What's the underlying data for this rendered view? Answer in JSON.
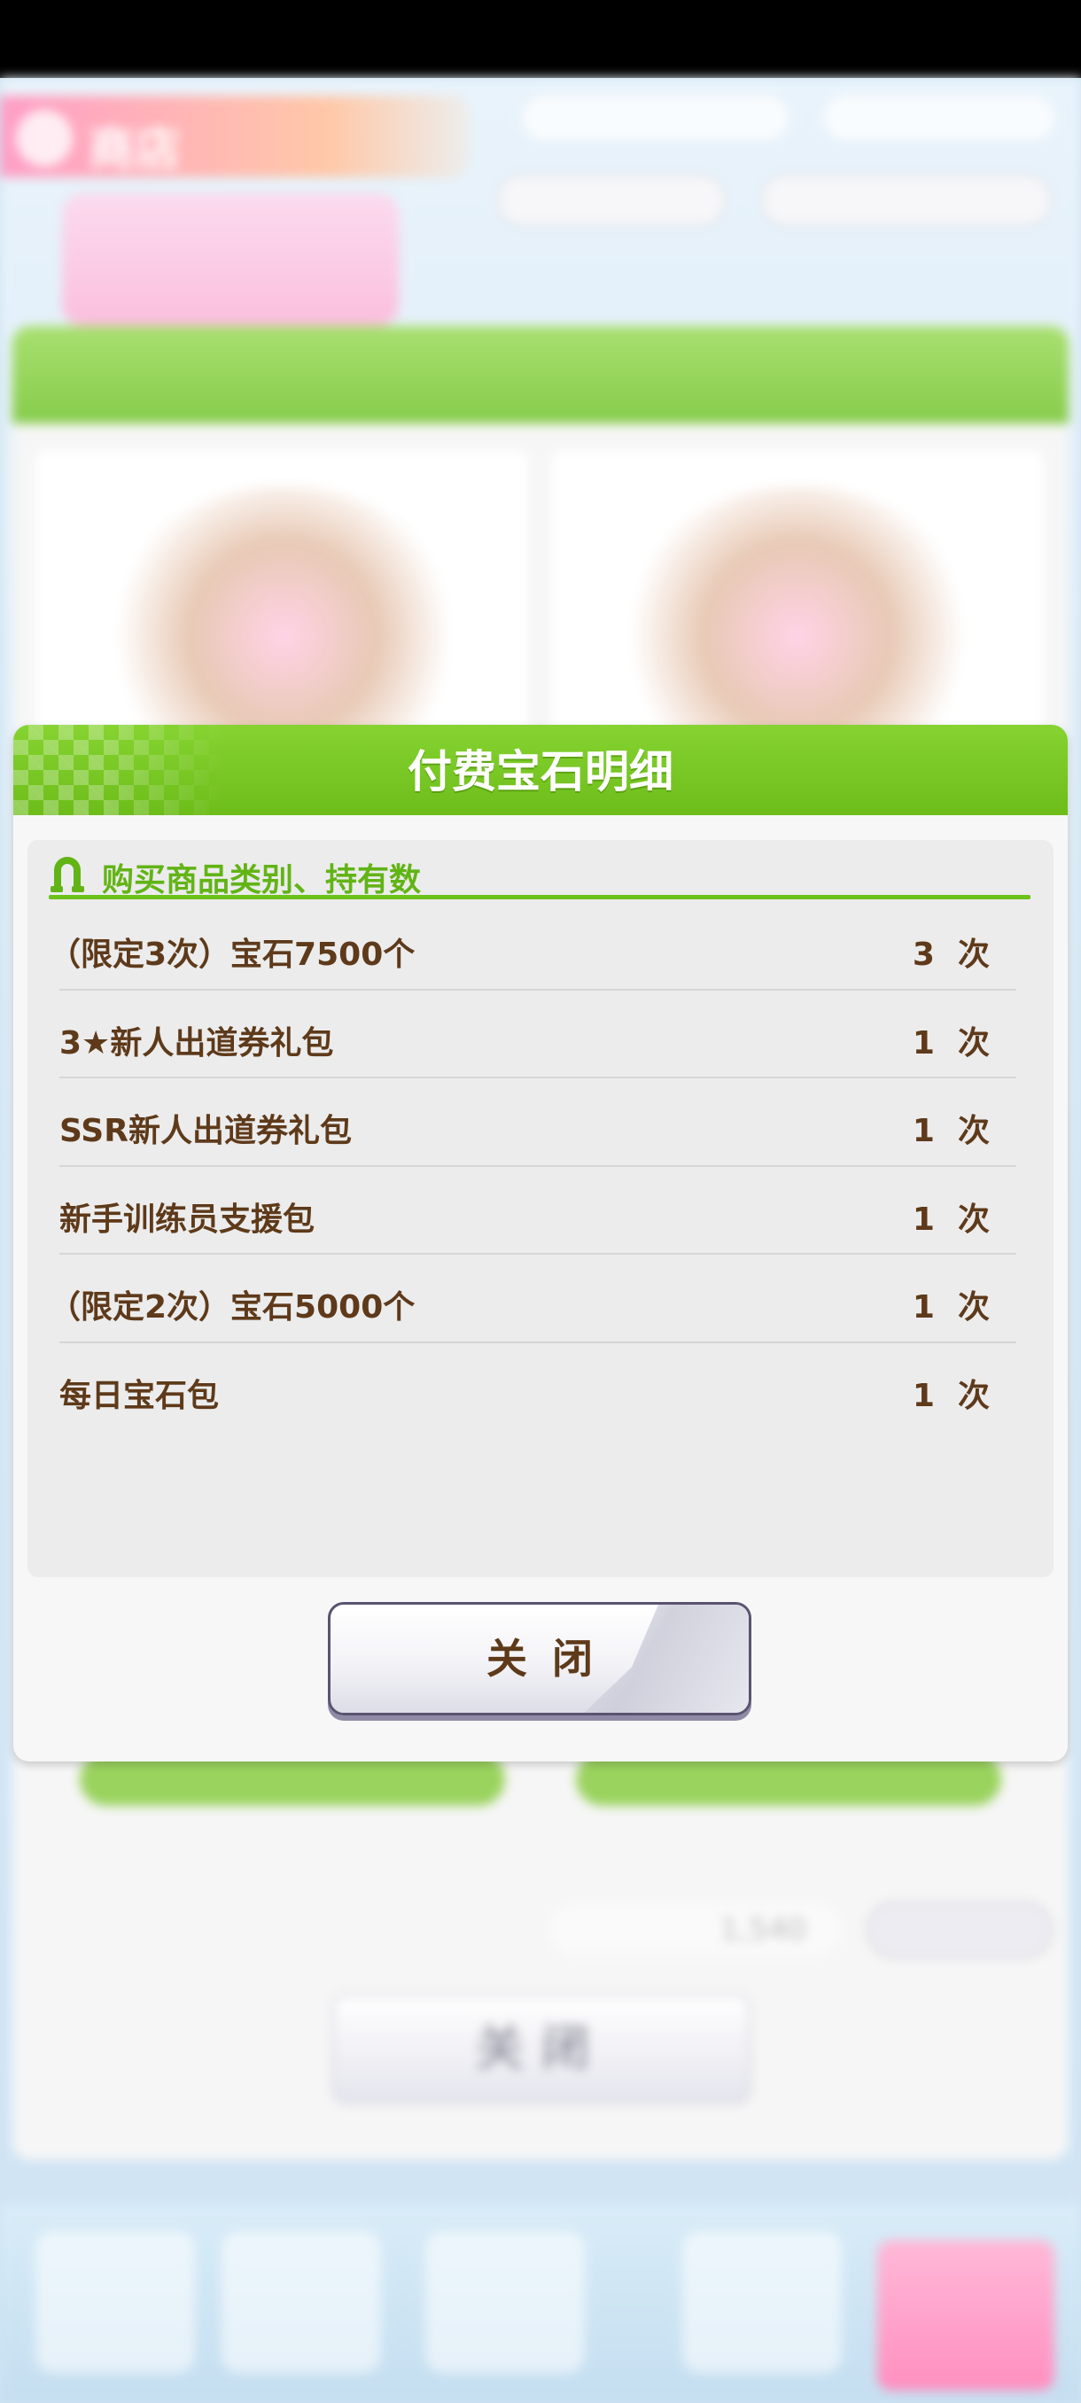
{
  "dialog": {
    "title": "付费宝石明细",
    "section_title": "购买商品类别、持有数",
    "count_unit": "次",
    "items": [
      {
        "name": "（限定3次）宝石7500个",
        "count": "3"
      },
      {
        "name": "3★新人出道券礼包",
        "count": "1"
      },
      {
        "name": "SSR新人出道券礼包",
        "count": "1"
      },
      {
        "name": "新手训练员支援包",
        "count": "1"
      },
      {
        "name": "（限定2次）宝石5000个",
        "count": "1"
      },
      {
        "name": "每日宝石包",
        "count": "1"
      }
    ],
    "close_label": "关闭"
  },
  "background": {
    "header_title": "商店",
    "total_amount": "1,540",
    "close_label": "关闭"
  },
  "colors": {
    "header_green": "#6dbd1a",
    "section_green": "#62b416",
    "text_brown": "#5e3a1a"
  },
  "icons": {
    "section_icon": "horseshoe-icon"
  }
}
